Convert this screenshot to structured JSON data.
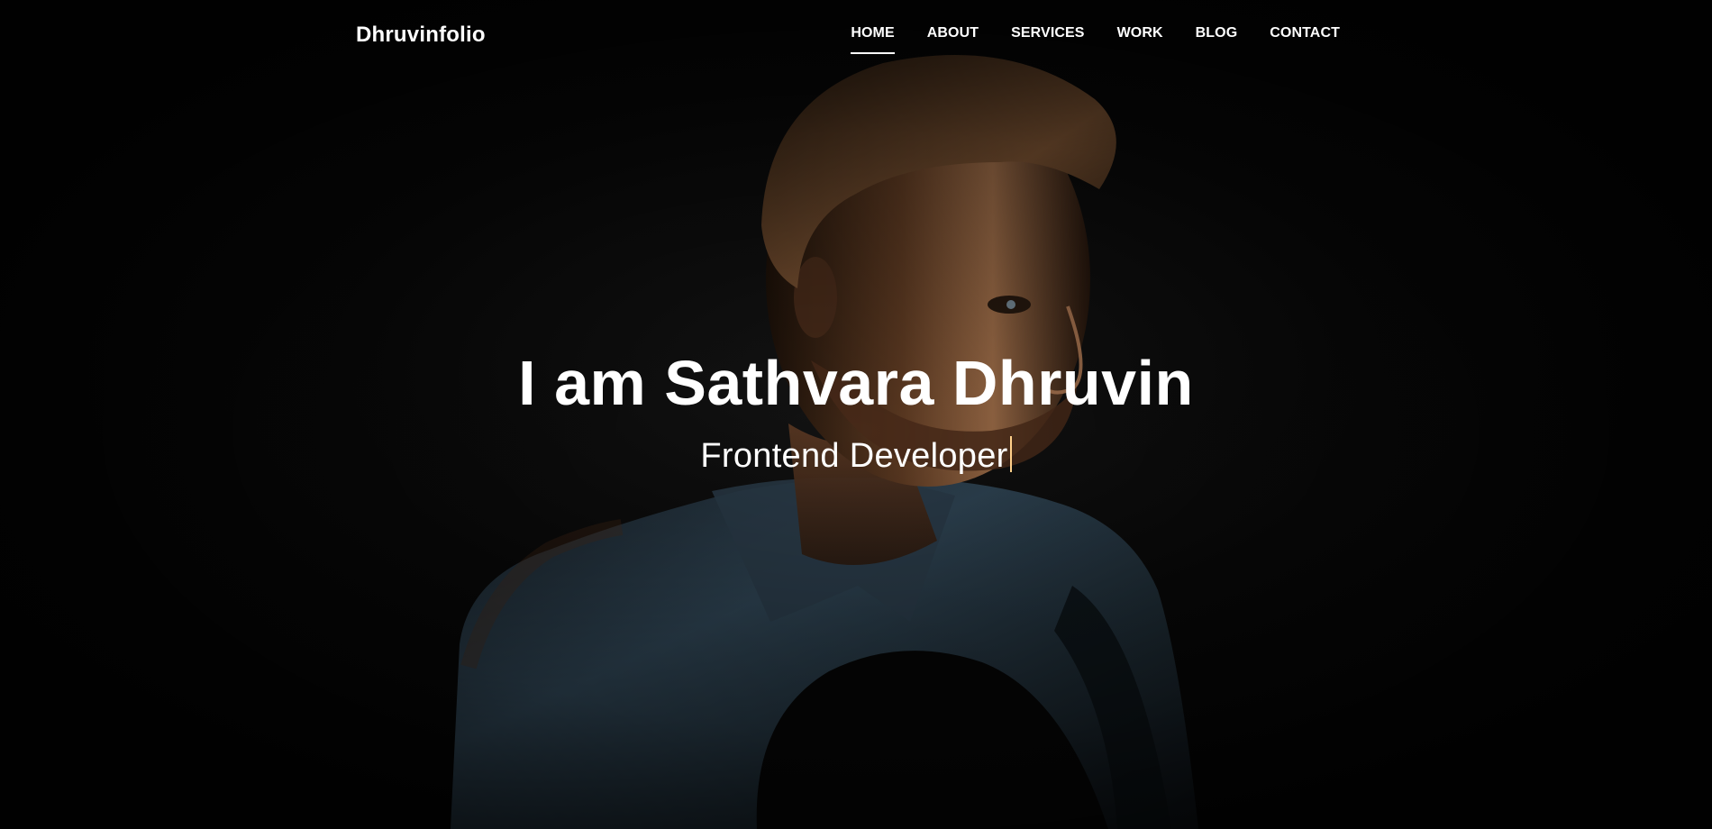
{
  "navbar": {
    "brand": "Dhruvinfolio",
    "items": [
      {
        "label": "HOME",
        "active": true
      },
      {
        "label": "ABOUT"
      },
      {
        "label": "SERVICES"
      },
      {
        "label": "WORK"
      },
      {
        "label": "BLOG"
      },
      {
        "label": "CONTACT"
      }
    ]
  },
  "hero": {
    "title": "I am Sathvara Dhruvin",
    "subtitle": "Frontend Developer"
  },
  "colors": {
    "background": "#030303",
    "text": "#ffffff",
    "typing_cursor": "#ffd08a"
  }
}
